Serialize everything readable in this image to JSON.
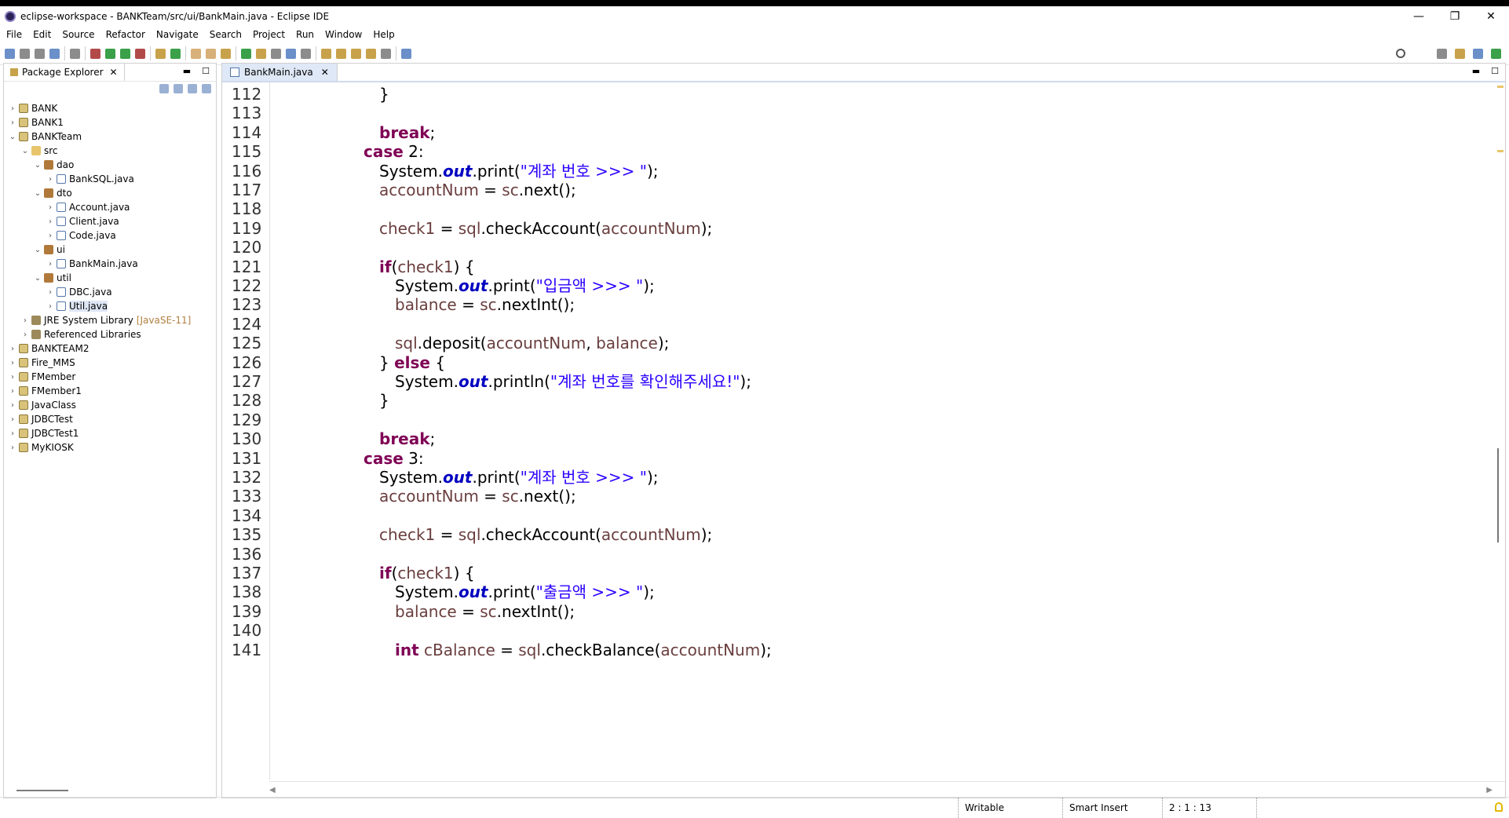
{
  "window": {
    "title": "eclipse-workspace - BANKTeam/src/ui/BankMain.java - Eclipse IDE",
    "controls": [
      "—",
      "❐",
      "✕"
    ]
  },
  "menu": [
    "File",
    "Edit",
    "Source",
    "Refactor",
    "Navigate",
    "Search",
    "Project",
    "Run",
    "Window",
    "Help"
  ],
  "explorer": {
    "tab_label": "Package Explorer",
    "tree": [
      {
        "label": "BANK",
        "type": "project",
        "expanded": false
      },
      {
        "label": "BANK1",
        "type": "project",
        "expanded": false
      },
      {
        "label": "BANKTeam",
        "type": "project",
        "expanded": true
      },
      {
        "label": "src",
        "type": "src",
        "expanded": true
      },
      {
        "label": "dao",
        "type": "package",
        "expanded": true
      },
      {
        "label": "BankSQL.java",
        "type": "java",
        "expanded": false
      },
      {
        "label": "dto",
        "type": "package",
        "expanded": true
      },
      {
        "label": "Account.java",
        "type": "java",
        "expanded": false
      },
      {
        "label": "Client.java",
        "type": "java",
        "expanded": false
      },
      {
        "label": "Code.java",
        "type": "java",
        "expanded": false
      },
      {
        "label": "ui",
        "type": "package",
        "expanded": true
      },
      {
        "label": "BankMain.java",
        "type": "java",
        "expanded": false
      },
      {
        "label": "util",
        "type": "package",
        "expanded": true
      },
      {
        "label": "DBC.java",
        "type": "java",
        "expanded": false
      },
      {
        "label": "Util.java",
        "type": "java",
        "expanded": false,
        "selected": true
      },
      {
        "label": "JRE System Library",
        "decoration": "[JavaSE-11]",
        "type": "library",
        "expanded": false
      },
      {
        "label": "Referenced Libraries",
        "type": "library",
        "expanded": false
      },
      {
        "label": "BANKTEAM2",
        "type": "project",
        "expanded": false
      },
      {
        "label": "Fire_MMS",
        "type": "project",
        "expanded": false
      },
      {
        "label": "FMember",
        "type": "project",
        "expanded": false
      },
      {
        "label": "FMember1",
        "type": "project",
        "expanded": false
      },
      {
        "label": "JavaClass",
        "type": "project",
        "expanded": false
      },
      {
        "label": "JDBCTest",
        "type": "project",
        "expanded": false
      },
      {
        "label": "JDBCTest1",
        "type": "project",
        "expanded": false
      },
      {
        "label": "MyKIOSK",
        "type": "project",
        "expanded": false
      }
    ]
  },
  "editor": {
    "tab_label": "BankMain.java",
    "lines": [
      {
        "n": "112",
        "indent": 7,
        "tokens": [
          [
            "p",
            "}"
          ]
        ]
      },
      {
        "n": "113",
        "indent": 0,
        "tokens": []
      },
      {
        "n": "114",
        "indent": 7,
        "tokens": [
          [
            "kw",
            "break"
          ],
          [
            "p",
            ";"
          ]
        ]
      },
      {
        "n": "115",
        "indent": 6,
        "tokens": [
          [
            "kw",
            "case"
          ],
          [
            "p",
            " 2:"
          ]
        ]
      },
      {
        "n": "116",
        "indent": 7,
        "tokens": [
          [
            "p",
            "System."
          ],
          [
            "fld",
            "out"
          ],
          [
            "p",
            ".print("
          ],
          [
            "str",
            "\"계좌 번호 >>> \""
          ],
          [
            "p",
            ");"
          ]
        ]
      },
      {
        "n": "117",
        "indent": 7,
        "tokens": [
          [
            "var",
            "accountNum"
          ],
          [
            "p",
            " = "
          ],
          [
            "var",
            "sc"
          ],
          [
            "p",
            ".next();"
          ]
        ]
      },
      {
        "n": "118",
        "indent": 0,
        "tokens": []
      },
      {
        "n": "119",
        "indent": 7,
        "tokens": [
          [
            "var",
            "check1"
          ],
          [
            "p",
            " = "
          ],
          [
            "var",
            "sql"
          ],
          [
            "p",
            ".checkAccount("
          ],
          [
            "var",
            "accountNum"
          ],
          [
            "p",
            ");"
          ]
        ]
      },
      {
        "n": "120",
        "indent": 0,
        "tokens": []
      },
      {
        "n": "121",
        "indent": 7,
        "tokens": [
          [
            "kw",
            "if"
          ],
          [
            "p",
            "("
          ],
          [
            "var",
            "check1"
          ],
          [
            "p",
            ") {"
          ]
        ]
      },
      {
        "n": "122",
        "indent": 8,
        "tokens": [
          [
            "p",
            "System."
          ],
          [
            "fld",
            "out"
          ],
          [
            "p",
            ".print("
          ],
          [
            "str",
            "\"입금액 >>> \""
          ],
          [
            "p",
            ");"
          ]
        ]
      },
      {
        "n": "123",
        "indent": 8,
        "tokens": [
          [
            "var",
            "balance"
          ],
          [
            "p",
            " = "
          ],
          [
            "var",
            "sc"
          ],
          [
            "p",
            ".nextInt();"
          ]
        ]
      },
      {
        "n": "124",
        "indent": 0,
        "tokens": []
      },
      {
        "n": "125",
        "indent": 8,
        "tokens": [
          [
            "var",
            "sql"
          ],
          [
            "p",
            ".deposit("
          ],
          [
            "var",
            "accountNum"
          ],
          [
            "p",
            ", "
          ],
          [
            "var",
            "balance"
          ],
          [
            "p",
            ");"
          ]
        ]
      },
      {
        "n": "126",
        "indent": 7,
        "tokens": [
          [
            "p",
            "} "
          ],
          [
            "kw",
            "else"
          ],
          [
            "p",
            " {"
          ]
        ]
      },
      {
        "n": "127",
        "indent": 8,
        "tokens": [
          [
            "p",
            "System."
          ],
          [
            "fld",
            "out"
          ],
          [
            "p",
            ".println("
          ],
          [
            "str",
            "\"계좌 번호를 확인해주세요!\""
          ],
          [
            "p",
            ");"
          ]
        ]
      },
      {
        "n": "128",
        "indent": 7,
        "tokens": [
          [
            "p",
            "}"
          ]
        ]
      },
      {
        "n": "129",
        "indent": 0,
        "tokens": []
      },
      {
        "n": "130",
        "indent": 7,
        "tokens": [
          [
            "kw",
            "break"
          ],
          [
            "p",
            ";"
          ]
        ]
      },
      {
        "n": "131",
        "indent": 6,
        "tokens": [
          [
            "kw",
            "case"
          ],
          [
            "p",
            " 3:"
          ]
        ]
      },
      {
        "n": "132",
        "indent": 7,
        "tokens": [
          [
            "p",
            "System."
          ],
          [
            "fld",
            "out"
          ],
          [
            "p",
            ".print("
          ],
          [
            "str",
            "\"계좌 번호 >>> \""
          ],
          [
            "p",
            ");"
          ]
        ]
      },
      {
        "n": "133",
        "indent": 7,
        "tokens": [
          [
            "var",
            "accountNum"
          ],
          [
            "p",
            " = "
          ],
          [
            "var",
            "sc"
          ],
          [
            "p",
            ".next();"
          ]
        ]
      },
      {
        "n": "134",
        "indent": 0,
        "tokens": []
      },
      {
        "n": "135",
        "indent": 7,
        "tokens": [
          [
            "var",
            "check1"
          ],
          [
            "p",
            " = "
          ],
          [
            "var",
            "sql"
          ],
          [
            "p",
            ".checkAccount("
          ],
          [
            "var",
            "accountNum"
          ],
          [
            "p",
            ");"
          ]
        ]
      },
      {
        "n": "136",
        "indent": 0,
        "tokens": []
      },
      {
        "n": "137",
        "indent": 7,
        "tokens": [
          [
            "kw",
            "if"
          ],
          [
            "p",
            "("
          ],
          [
            "var",
            "check1"
          ],
          [
            "p",
            ") {"
          ]
        ]
      },
      {
        "n": "138",
        "indent": 8,
        "tokens": [
          [
            "p",
            "System."
          ],
          [
            "fld",
            "out"
          ],
          [
            "p",
            ".print("
          ],
          [
            "str",
            "\"출금액 >>> \""
          ],
          [
            "p",
            ");"
          ]
        ]
      },
      {
        "n": "139",
        "indent": 8,
        "tokens": [
          [
            "var",
            "balance"
          ],
          [
            "p",
            " = "
          ],
          [
            "var",
            "sc"
          ],
          [
            "p",
            ".nextInt();"
          ]
        ]
      },
      {
        "n": "140",
        "indent": 0,
        "tokens": []
      },
      {
        "n": "141",
        "indent": 8,
        "tokens": [
          [
            "kw",
            "int"
          ],
          [
            "p",
            " "
          ],
          [
            "var",
            "cBalance"
          ],
          [
            "p",
            " = "
          ],
          [
            "var",
            "sql"
          ],
          [
            "p",
            ".checkBalance("
          ],
          [
            "var",
            "accountNum"
          ],
          [
            "p",
            ");"
          ]
        ]
      }
    ]
  },
  "status": {
    "writable": "Writable",
    "insert_mode": "Smart Insert",
    "position": "2 : 1 : 13"
  }
}
